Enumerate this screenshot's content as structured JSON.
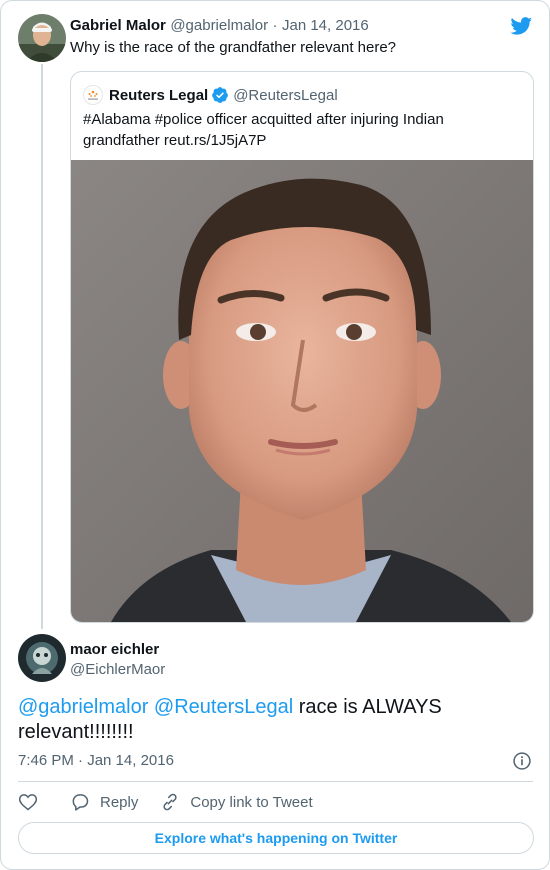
{
  "tweet": {
    "author_name": "Gabriel Malor",
    "author_handle": "@gabrielmalor",
    "separator": "·",
    "date": "Jan 14, 2016",
    "text": "Why is the race of the grandfather relevant here?"
  },
  "quoted_tweet": {
    "author_name": "Reuters Legal",
    "author_handle": "@ReutersLegal",
    "text": "#Alabama #police officer acquitted after injuring Indian grandfather reut.rs/1J5jA7P"
  },
  "reply": {
    "author_name": "maor eichler",
    "author_handle": "@EichlerMaor",
    "mention_1": "@gabrielmalor",
    "mention_2": "@ReutersLegal",
    "text": "race is ALWAYS relevant!!!!!!!!",
    "timestamp": "7:46 PM · Jan 14, 2016"
  },
  "actions": {
    "reply_label": "Reply",
    "copy_link_label": "Copy link to Tweet"
  },
  "explore_label": "Explore what's happening on Twitter",
  "colors": {
    "accent": "#1d9bf0",
    "text": "#0f1419",
    "muted": "#536471",
    "border": "#cfd9de"
  },
  "icons": [
    "twitter-bird-icon",
    "verified-badge-icon",
    "info-icon",
    "heart-icon",
    "reply-bubble-icon",
    "link-icon"
  ]
}
